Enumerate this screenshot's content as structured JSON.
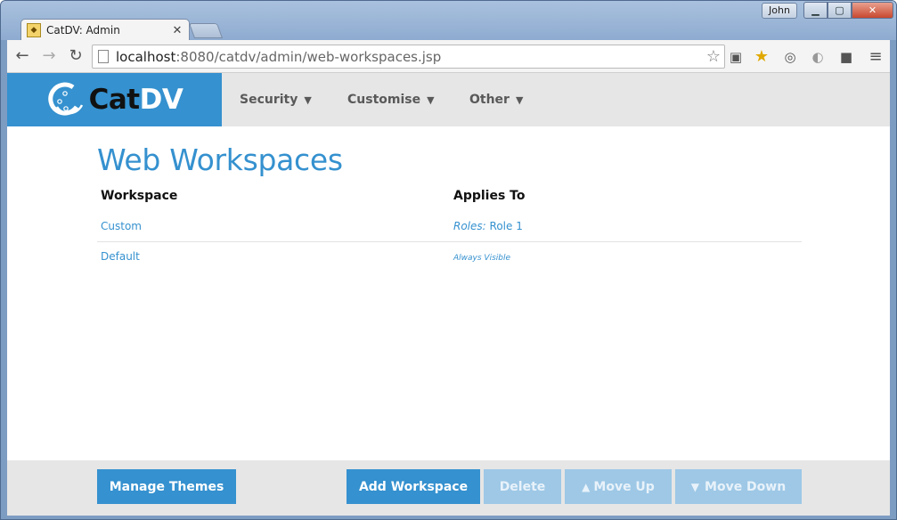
{
  "browser": {
    "tab_title": "CatDV: Admin",
    "user_badge": "John",
    "url_host": "localhost",
    "url_rest": ":8080/catdv/admin/web-workspaces.jsp"
  },
  "app": {
    "brand": {
      "part1": "Cat",
      "part2": "DV"
    },
    "menu": [
      {
        "label": "Security"
      },
      {
        "label": "Customise"
      },
      {
        "label": "Other"
      }
    ]
  },
  "page": {
    "title": "Web Workspaces",
    "columns": {
      "workspace": "Workspace",
      "applies_to": "Applies To"
    },
    "rows": [
      {
        "workspace": "Custom",
        "applies_label": "Roles:",
        "applies_value": "Role 1"
      },
      {
        "workspace": "Default",
        "applies_value": "Always Visible"
      }
    ]
  },
  "footer": {
    "manage_themes": "Manage Themes",
    "add_workspace": "Add Workspace",
    "delete": "Delete",
    "move_up": "Move Up",
    "move_down": "Move Down"
  },
  "colors": {
    "accent": "#3591cf",
    "header_bg": "#e6e6e6",
    "disabled_button": "#9ec8e6"
  },
  "icons": [
    "back-arrow-icon",
    "forward-arrow-icon",
    "reload-icon",
    "bookmark-star-icon",
    "menu-icon"
  ]
}
